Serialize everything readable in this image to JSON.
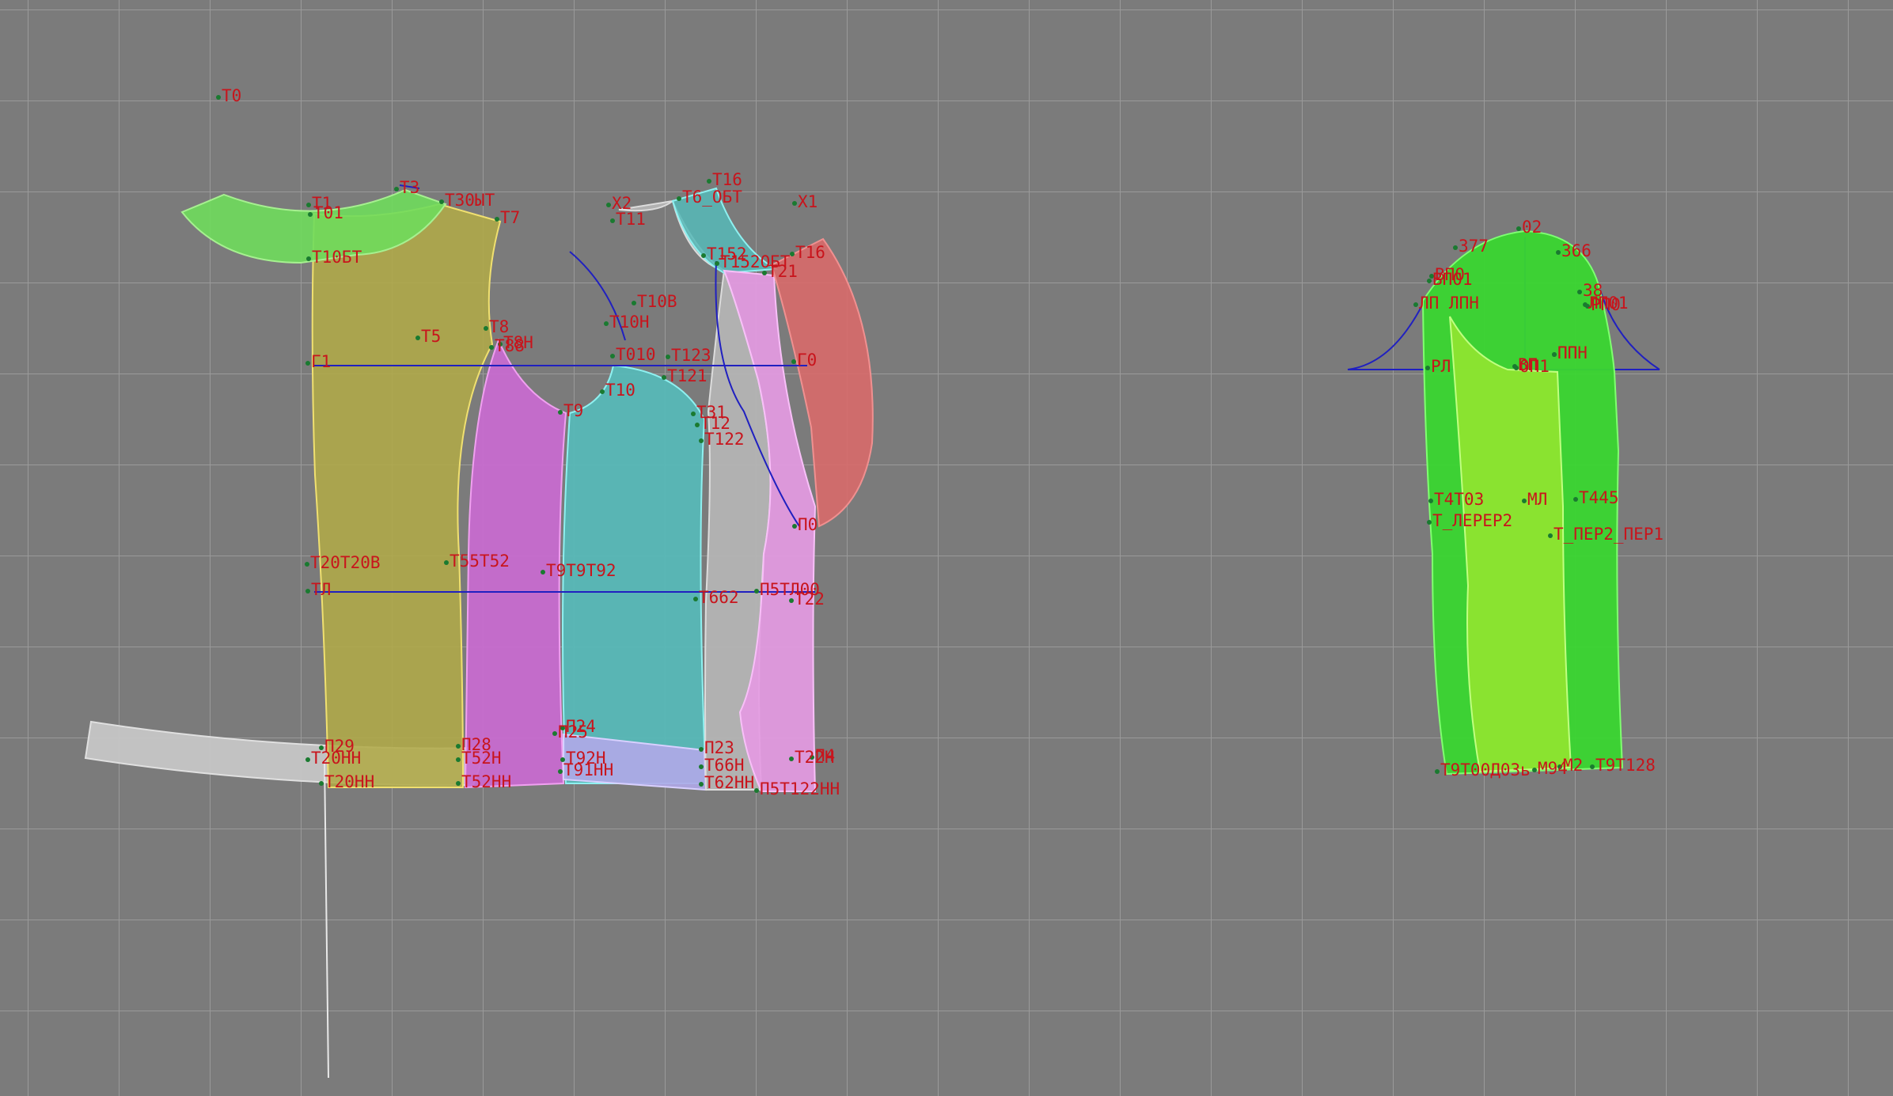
{
  "colors": {
    "background": "#7b7b7b",
    "grid": "#9a9a9a",
    "construction": "#2020c0",
    "label": "#c8141c",
    "point": "#1a7a30",
    "yoke": "#6fdc5c",
    "front": "#b0aa48",
    "side_front": "#c96ad0",
    "side_back": "#56bab8",
    "back": "#b4b4b4",
    "back_piece": "#e49ae2",
    "facing": "#d86a6a",
    "waistband": "#c8c8c8",
    "hem_band": "#b0a8e8",
    "sleeve_main": "#3ad630",
    "sleeve_inner": "#8ee430"
  },
  "icons": {
    "point_marker": "dot-icon"
  },
  "labels": [
    "T0",
    "T1",
    "T01",
    "T3",
    "T30ЫТ",
    "T7",
    "T10БТ",
    "T5",
    "T8",
    "T8Н",
    "T88",
    "Г1",
    "T20T20В",
    "T55T52",
    "T9T9T92",
    "T9",
    "T10",
    "TЛ",
    "П29",
    "T20НН",
    "T20НН",
    "П28",
    "T52Н",
    "T52НН",
    "П25",
    "П24",
    "T92Н",
    "T91НН",
    "Х2",
    "T11",
    "T16",
    "T6_ОБТ",
    "Х1",
    "T10В",
    "T10Н",
    "T010",
    "T123",
    "T121",
    "Г0",
    "T31",
    "T12",
    "T122",
    "T152",
    "T152ОБТ",
    "T16",
    "T21",
    "П0",
    "T662",
    "П5TЛ00",
    "T22",
    "П23",
    "T66Н",
    "T62НН",
    "T22Н",
    "П4",
    "П5T122НН",
    "02",
    "377",
    "366",
    "ВП0",
    "ВП01",
    "38",
    "ЛП01",
    "РП0",
    "ЛП ЛПН",
    "РЛ",
    "ВП",
    "ОП1",
    "ППН",
    "ПП",
    "T4Т03",
    "МЛ",
    "T445",
    "Т_ЛЕРЕР2",
    "Т_ПЕР2_ПЕР1",
    "Т9T00Д03ь",
    "М94",
    "М2",
    "Т9Т128"
  ]
}
